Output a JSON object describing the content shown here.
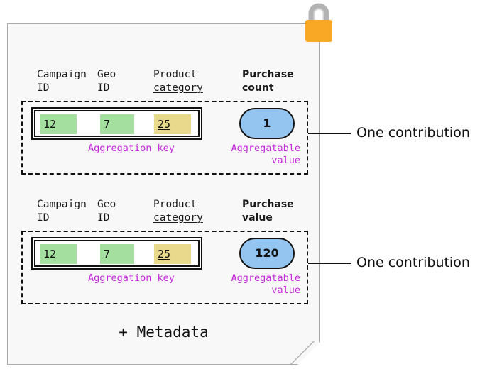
{
  "document": {
    "lock_icon": "padlock-icon",
    "metadata_label": "+ Metadata",
    "fill_color": "#f8f8f8",
    "border_color": "#a9a9a9"
  },
  "colors": {
    "lock_body": "#f9a825",
    "lock_shackle": "#b3b3b3",
    "key_green": "#a5dfa0",
    "key_yellow": "#e9d98d",
    "value_blue": "#93c5f0",
    "annotation_purple": "#c428dc",
    "outline_black": "#111111"
  },
  "contributions": [
    {
      "headers": {
        "campaign_id": "Campaign\nID",
        "geo_id": "Geo\nID",
        "product_category": "Product\ncategory",
        "metric": "Purchase\ncount"
      },
      "aggregation_key": {
        "campaign_id": "12",
        "geo_id": "7",
        "product_category": "25"
      },
      "aggregatable_value": "1",
      "key_annotation": "Aggregation key",
      "value_annotation": "Aggregatable\nvalue",
      "callout": "One contribution"
    },
    {
      "headers": {
        "campaign_id": "Campaign\nID",
        "geo_id": "Geo\nID",
        "product_category": "Product\ncategory",
        "metric": "Purchase\nvalue"
      },
      "aggregation_key": {
        "campaign_id": "12",
        "geo_id": "7",
        "product_category": "25"
      },
      "aggregatable_value": "120",
      "key_annotation": "Aggregation key",
      "value_annotation": "Aggregatable\nvalue",
      "callout": "One contribution"
    }
  ]
}
